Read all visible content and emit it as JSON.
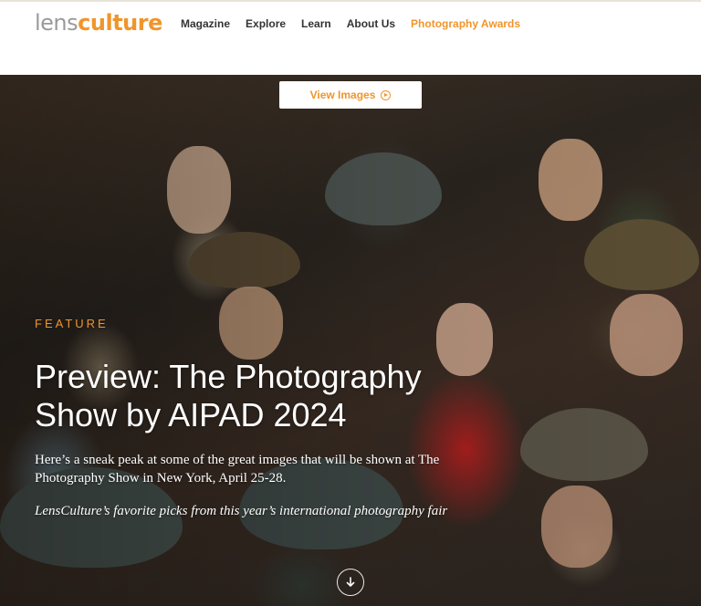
{
  "header": {
    "logo": {
      "lens": "lens",
      "culture": "culture"
    },
    "nav": [
      {
        "label": "Magazine"
      },
      {
        "label": "Explore"
      },
      {
        "label": "Learn"
      },
      {
        "label": "About Us"
      },
      {
        "label": "Photography Awards"
      }
    ]
  },
  "hero": {
    "view_button_label": "View Images",
    "view_button_icon": "play-circle-icon",
    "kicker": "FEATURE",
    "title": "Preview: The Photography Show by AIPAD 2024",
    "description": "Here’s a sneak peak at some of the great images that will be shown at The Photography Show in New York, April 25-28.",
    "subdescription": "LensCulture’s favorite picks from this year’s international photography fair",
    "scroll_icon": "arrow-down-circle-icon"
  },
  "colors": {
    "accent": "#f0952b",
    "logo_gray": "#9a9a9a",
    "nav_text": "#333333"
  }
}
